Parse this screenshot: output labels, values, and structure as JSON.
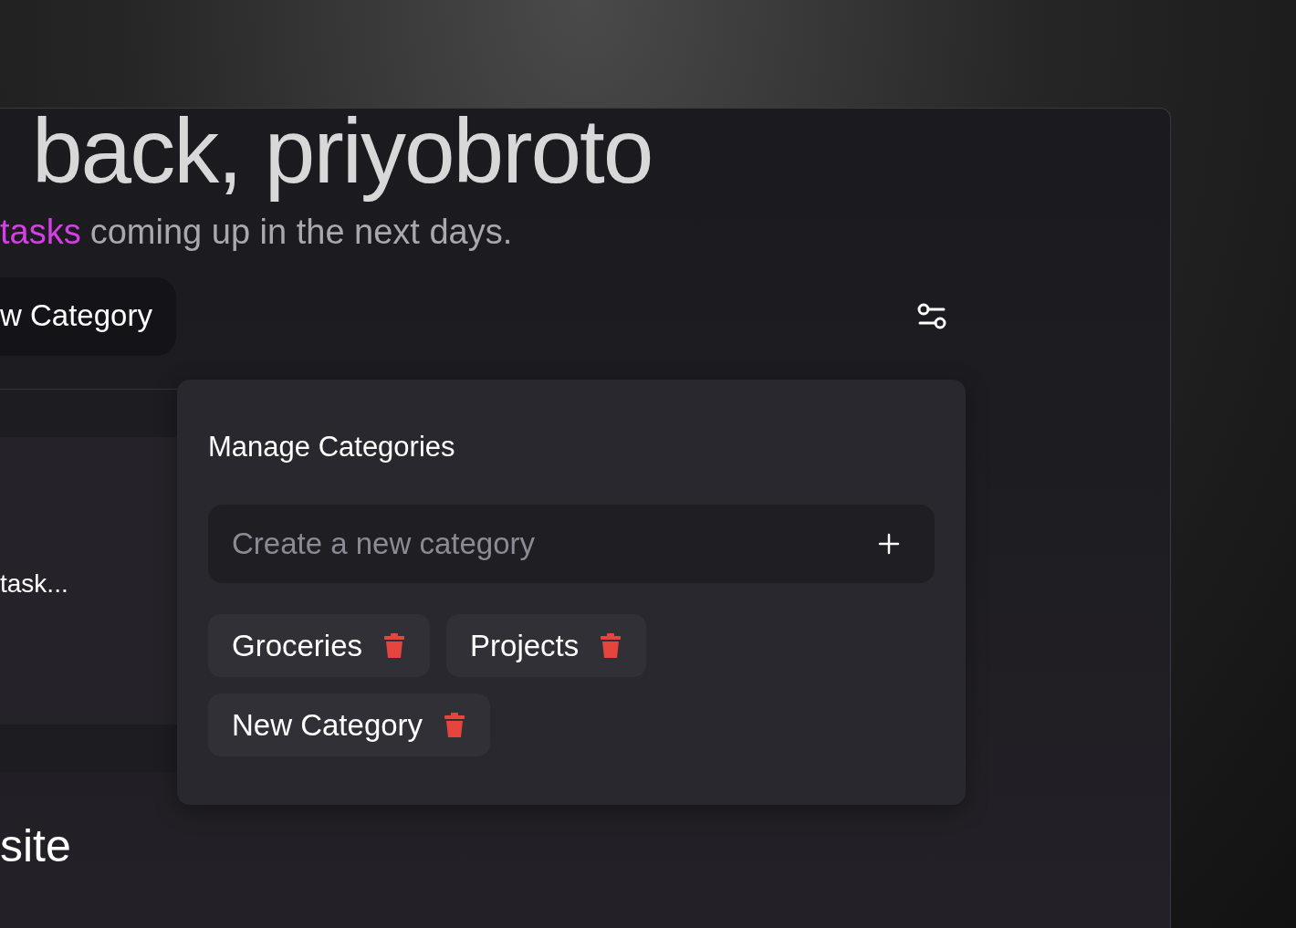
{
  "heading": "back, priyobroto",
  "subtitle": {
    "highlight": "tasks",
    "text": "coming up in the next days."
  },
  "new_category_button": "w Category",
  "task_card": {
    "title": "task..."
  },
  "section_heading": "site",
  "manage_categories": {
    "title": "Manage Categories",
    "input": {
      "placeholder": "Create a new category"
    },
    "categories": [
      {
        "label": "Groceries"
      },
      {
        "label": "Projects"
      },
      {
        "label": "New Category"
      }
    ]
  }
}
